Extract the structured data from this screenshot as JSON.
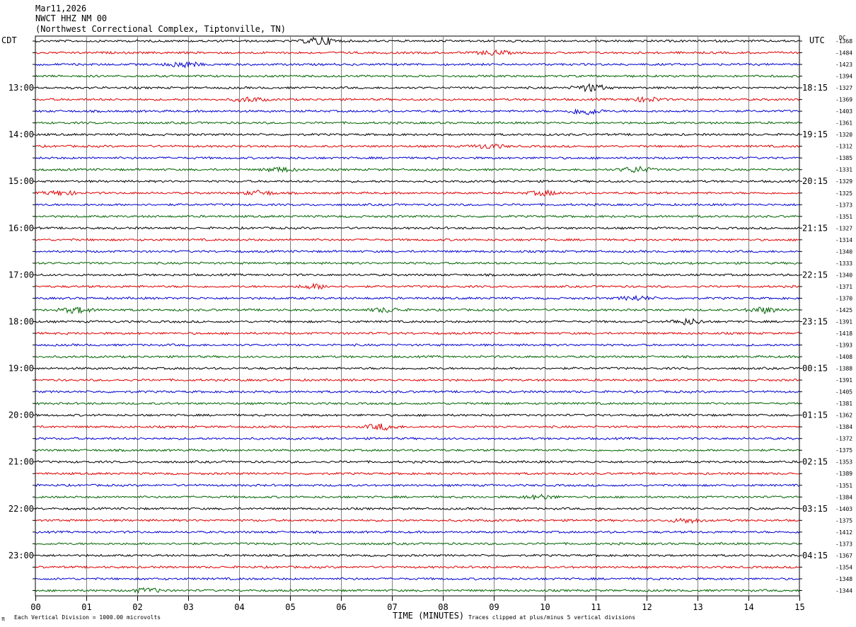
{
  "header": {
    "date": "Mar11,2026",
    "channel": "NWCT HHZ NM 00",
    "site": "(Northwest Correctional Complex, Tiptonville, TN)"
  },
  "labels": {
    "left_tz": "CDT",
    "right_tz": "UTC",
    "dc": "DC",
    "xlabel": "TIME (MINUTES)",
    "scale_note": "Each Vertical Division = 1000.00 microvolts",
    "clip_note": "Traces clipped at plus/minus 5 vertical divisions",
    "corner_mark": "π"
  },
  "chart_data": {
    "type": "line",
    "title": "Mar11,2026 NWCT HHZ NM 00 (Northwest Correctional Complex, Tiptonville, TN)",
    "xlabel": "TIME (MINUTES)",
    "xlim": [
      0,
      15
    ],
    "x_ticks": [
      "00",
      "01",
      "02",
      "03",
      "04",
      "05",
      "06",
      "07",
      "08",
      "09",
      "10",
      "11",
      "12",
      "13",
      "14",
      "15"
    ],
    "colors": [
      "#000000",
      "#e00000",
      "#0000d0",
      "#006400"
    ],
    "row_count": 48,
    "left_hour_labels": [
      "13:00",
      "14:00",
      "15:00",
      "16:00",
      "17:00",
      "18:00",
      "19:00",
      "20:00",
      "21:00",
      "22:00",
      "23:00"
    ],
    "right_hour_labels": [
      "18:15",
      "19:15",
      "20:15",
      "21:15",
      "22:15",
      "23:15",
      "00:15",
      "01:15",
      "02:15",
      "03:15",
      "04:15"
    ],
    "hour_label_start_row": 4,
    "dc_offsets": [
      -1368,
      -1484,
      -1423,
      -1394,
      -1327,
      -1369,
      -1403,
      -1361,
      -1320,
      -1312,
      -1385,
      -1331,
      -1329,
      -1325,
      -1373,
      -1351,
      -1327,
      -1314,
      -1340,
      -1333,
      -1340,
      -1371,
      -1370,
      -1425,
      -1391,
      -1418,
      -1393,
      -1408,
      -1388,
      -1391,
      -1405,
      -1381,
      -1362,
      -1384,
      -1372,
      -1375,
      -1353,
      -1389,
      -1351,
      -1384,
      -1403,
      -1375,
      -1412,
      -1373,
      -1367,
      -1354,
      -1348,
      -1344
    ],
    "events": [
      {
        "row": 0,
        "minute": 5.6,
        "amp": 6
      },
      {
        "row": 1,
        "minute": 9.0,
        "amp": 3
      },
      {
        "row": 2,
        "minute": 2.9,
        "amp": 4
      },
      {
        "row": 4,
        "minute": 10.9,
        "amp": 5
      },
      {
        "row": 5,
        "minute": 4.2,
        "amp": 3
      },
      {
        "row": 5,
        "minute": 12.0,
        "amp": 3
      },
      {
        "row": 6,
        "minute": 10.8,
        "amp": 5
      },
      {
        "row": 9,
        "minute": 8.9,
        "amp": 3
      },
      {
        "row": 11,
        "minute": 4.8,
        "amp": 3
      },
      {
        "row": 11,
        "minute": 11.8,
        "amp": 4
      },
      {
        "row": 13,
        "minute": 0.5,
        "amp": 3
      },
      {
        "row": 13,
        "minute": 4.4,
        "amp": 3
      },
      {
        "row": 13,
        "minute": 10.0,
        "amp": 3
      },
      {
        "row": 21,
        "minute": 5.5,
        "amp": 3
      },
      {
        "row": 22,
        "minute": 11.8,
        "amp": 3
      },
      {
        "row": 23,
        "minute": 0.8,
        "amp": 4
      },
      {
        "row": 23,
        "minute": 14.3,
        "amp": 4
      },
      {
        "row": 23,
        "minute": 6.9,
        "amp": 3
      },
      {
        "row": 24,
        "minute": 12.8,
        "amp": 4
      },
      {
        "row": 33,
        "minute": 6.8,
        "amp": 4
      },
      {
        "row": 39,
        "minute": 9.9,
        "amp": 3
      },
      {
        "row": 41,
        "minute": 12.8,
        "amp": 3
      },
      {
        "row": 47,
        "minute": 2.2,
        "amp": 3
      }
    ]
  }
}
